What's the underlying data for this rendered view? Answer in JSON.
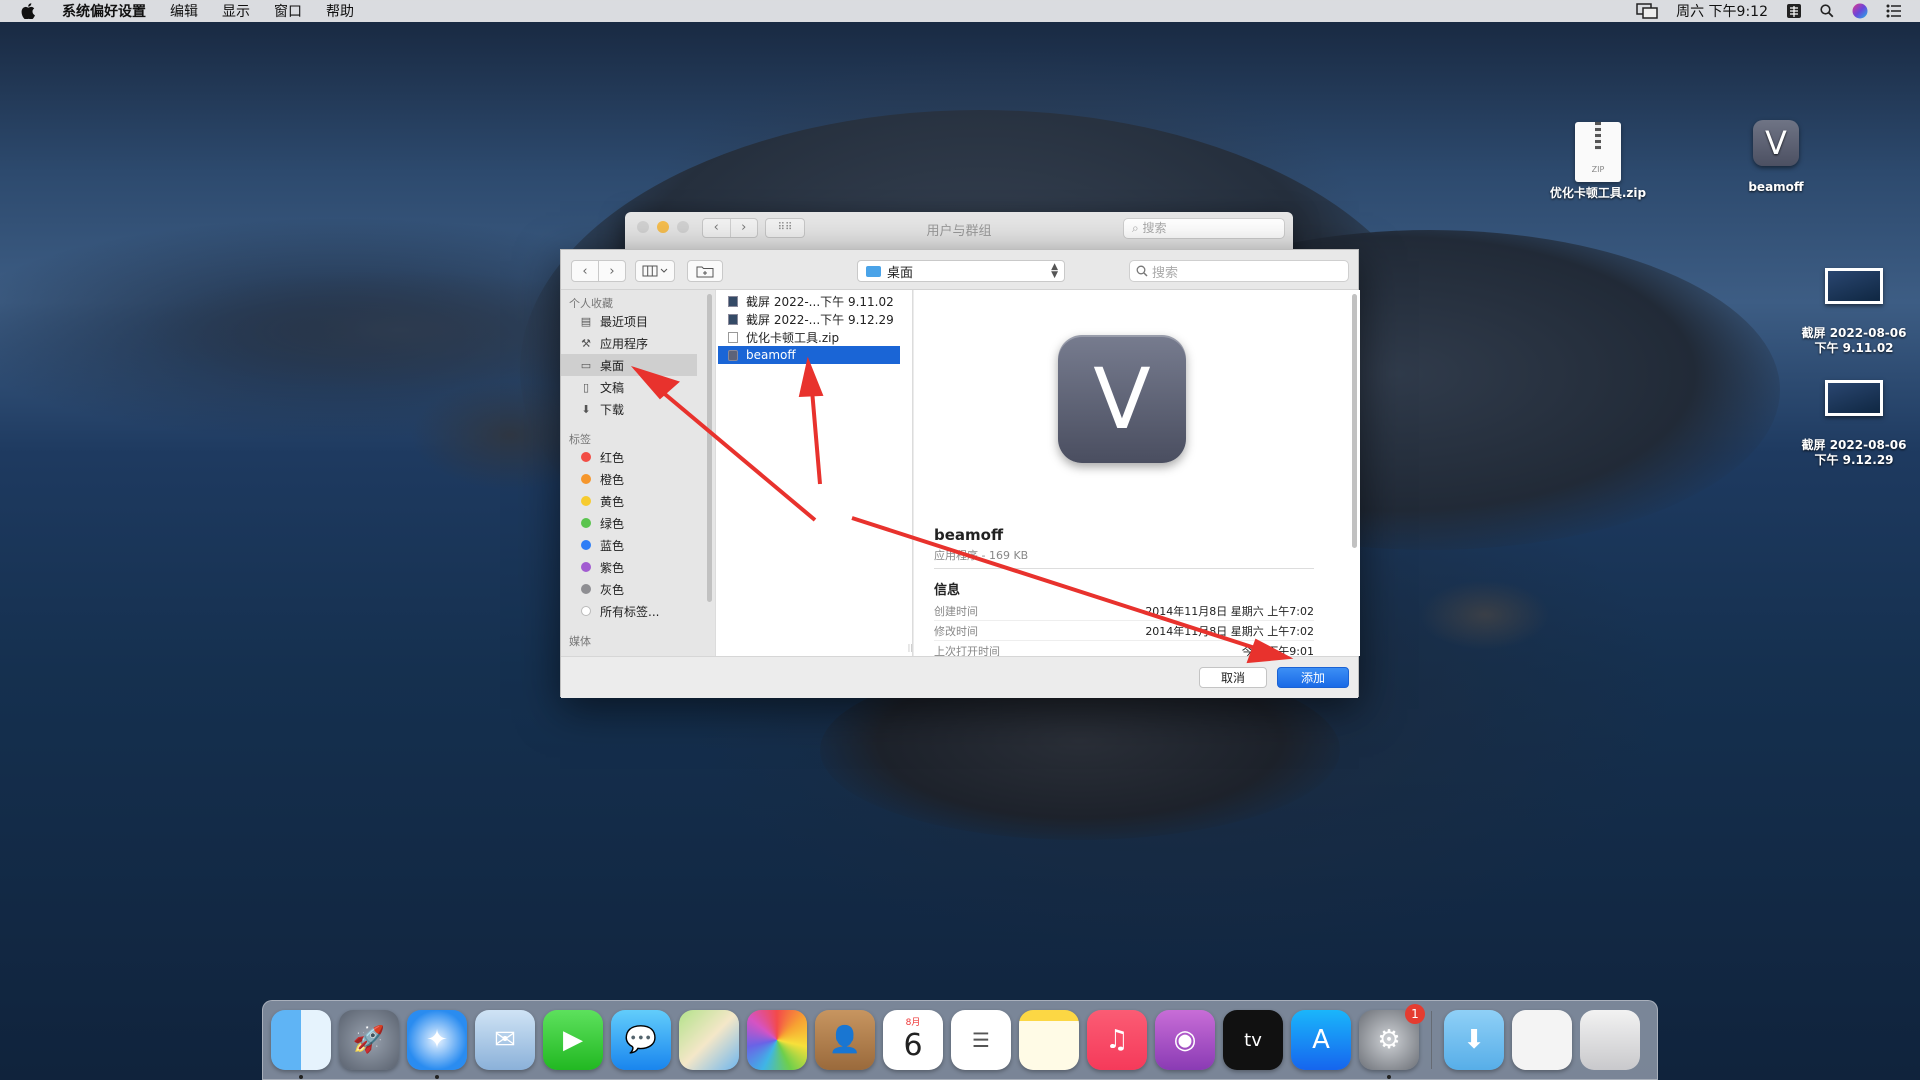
{
  "menubar": {
    "app_name": "系统偏好设置",
    "items": [
      "编辑",
      "显示",
      "窗口",
      "帮助"
    ],
    "clock": "周六 下午9:12"
  },
  "desktop": {
    "icons": [
      {
        "label": "优化卡顿工具.zip",
        "kind": "zip",
        "zip_tag": "ZIP"
      },
      {
        "label": "beamoff",
        "kind": "app",
        "glyph": "V"
      },
      {
        "label_line1": "截屏 2022-08-06",
        "label_line2": "下午 9.11.02",
        "kind": "screenshot"
      },
      {
        "label_line1": "截屏 2022-08-06",
        "label_line2": "下午 9.12.29",
        "kind": "screenshot"
      }
    ]
  },
  "bg_window": {
    "title": "用户与群组",
    "search_placeholder": "搜索"
  },
  "dialog": {
    "location": "桌面",
    "search_placeholder": "搜索",
    "sidebar": {
      "favorites_header": "个人收藏",
      "favorites": [
        "最近项目",
        "应用程序",
        "桌面",
        "文稿",
        "下载"
      ],
      "tags_header": "标签",
      "tags": [
        {
          "label": "红色",
          "color": "#f24d45"
        },
        {
          "label": "橙色",
          "color": "#f5962c"
        },
        {
          "label": "黄色",
          "color": "#f6cb2f"
        },
        {
          "label": "绿色",
          "color": "#5ac44e"
        },
        {
          "label": "蓝色",
          "color": "#2f7ef6"
        },
        {
          "label": "紫色",
          "color": "#a25cd1"
        },
        {
          "label": "灰色",
          "color": "#8e8e92"
        }
      ],
      "all_tags": "所有标签...",
      "media_header": "媒体"
    },
    "files": [
      "截屏 2022-...下午 9.11.02",
      "截屏 2022-...下午 9.12.29",
      "优化卡顿工具.zip",
      "beamoff"
    ],
    "preview": {
      "icon_glyph": "V",
      "name": "beamoff",
      "meta": "应用程序 - 169 KB",
      "info_header": "信息",
      "rows": [
        {
          "key": "创建时间",
          "value": "2014年11月8日 星期六 上午7:02"
        },
        {
          "key": "修改时间",
          "value": "2014年11月8日 星期六 上午7:02"
        },
        {
          "key": "上次打开时间",
          "value": "今天 下午9:01"
        }
      ]
    },
    "cancel_label": "取消",
    "add_label": "添加"
  },
  "dock": {
    "calendar_month": "8月",
    "calendar_day": "6",
    "tv_label": "tv",
    "settings_badge": "1"
  }
}
